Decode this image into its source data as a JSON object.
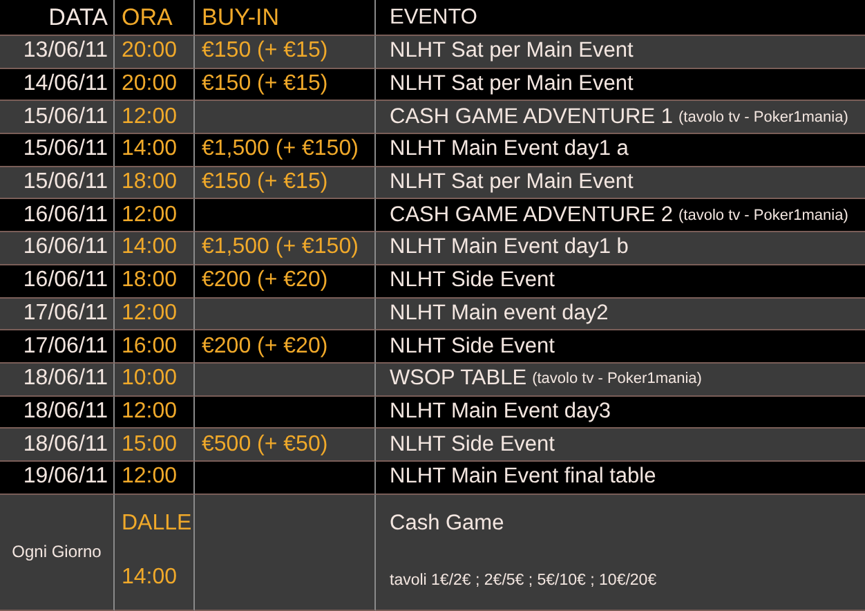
{
  "table": {
    "columns": [
      "DATA",
      "ORA",
      "BUY-IN",
      "EVENTO"
    ],
    "rows": [
      {
        "date": "13/06/11",
        "time": "20:00",
        "buy_in": "€150 (+ €15)",
        "event": "NLHT Sat per Main Event"
      },
      {
        "date": "14/06/11",
        "time": "20:00",
        "buy_in": "€150 (+ €15)",
        "event": "NLHT Sat per Main Event"
      },
      {
        "date": "15/06/11",
        "time": "12:00",
        "event": "CASH GAME ADVENTURE 1",
        "note": "(tavolo tv - Poker1mania)"
      },
      {
        "date": "15/06/11",
        "time": "14:00",
        "buy_in": "€1,500 (+ €150)",
        "event": "NLHT Main Event day1 a"
      },
      {
        "date": "15/06/11",
        "time": "18:00",
        "buy_in": "€150 (+ €15)",
        "event": "NLHT Sat per Main Event"
      },
      {
        "date": "16/06/11",
        "time": "12:00",
        "event": "CASH GAME ADVENTURE 2",
        "note": "(tavolo tv - Poker1mania)"
      },
      {
        "date": "16/06/11",
        "time": "14:00",
        "buy_in": "€1,500 (+ €150)",
        "event": "NLHT Main Event day1 b"
      },
      {
        "date": "16/06/11",
        "time": "18:00",
        "buy_in": "€200 (+ €20)",
        "event": "NLHT Side Event"
      },
      {
        "date": "17/06/11",
        "time": "12:00",
        "event": "NLHT Main event day2"
      },
      {
        "date": "17/06/11",
        "time": "16:00",
        "buy_in": "€200 (+ €20)",
        "event": "NLHT Side Event"
      },
      {
        "date": "18/06/11",
        "time": "10:00",
        "event": "WSOP TABLE",
        "note": "(tavolo tv - Poker1mania)"
      },
      {
        "date": "18/06/11",
        "time": "12:00",
        "event": "NLHT Main Event day3"
      },
      {
        "date": "18/06/11",
        "time": "15:00",
        "buy_in": "€500 (+ €50)",
        "event": "NLHT Side Event"
      },
      {
        "date": "19/06/11",
        "time": "12:00",
        "event": "NLHT Main Event final table"
      }
    ],
    "daily_row": {
      "date": "Ogni Giorno",
      "time_label": "DALLE",
      "time": "14:00",
      "event": "Cash Game",
      "detail": "tavoli 1€/2€ ; 2€/5€ ; 5€/10€ ; 10€/20€"
    }
  }
}
